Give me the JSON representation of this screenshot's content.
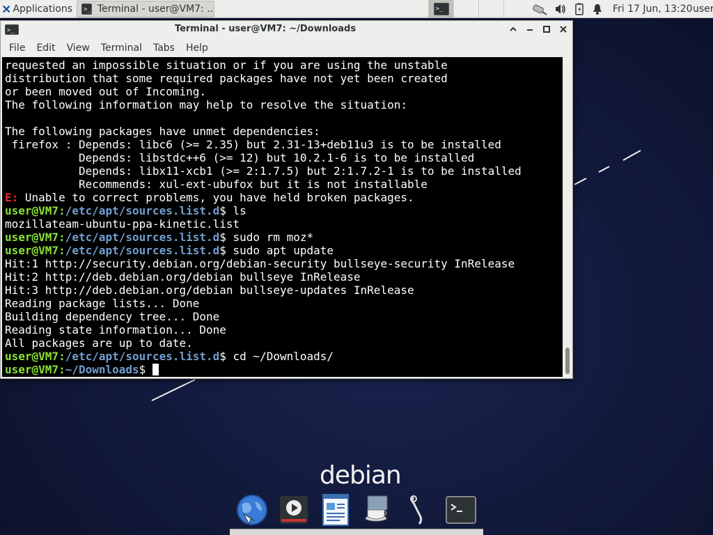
{
  "panel": {
    "applications_label": "Applications",
    "task_label": "Terminal - user@VM7: ...",
    "clock": "Fri 17 Jun, 13:20",
    "user": "user"
  },
  "window": {
    "title": "Terminal - user@VM7: ~/Downloads",
    "menu": [
      "File",
      "Edit",
      "View",
      "Terminal",
      "Tabs",
      "Help"
    ]
  },
  "terminal": {
    "lines": [
      {
        "text": "requested an impossible situation or if you are using the unstable"
      },
      {
        "text": "distribution that some required packages have not yet been created"
      },
      {
        "text": "or been moved out of Incoming."
      },
      {
        "text": "The following information may help to resolve the situation:"
      },
      {
        "text": ""
      },
      {
        "text": "The following packages have unmet dependencies:"
      },
      {
        "text": " firefox : Depends: libc6 (>= 2.35) but 2.31-13+deb11u3 is to be installed"
      },
      {
        "text": "           Depends: libstdc++6 (>= 12) but 10.2.1-6 is to be installed"
      },
      {
        "text": "           Depends: libx11-xcb1 (>= 2:1.7.5) but 2:1.7.2-1 is to be installed"
      },
      {
        "text": "           Recommends: xul-ext-ubufox but it is not installable"
      },
      {
        "error_tag": "E:",
        "text": " Unable to correct problems, you have held broken packages."
      },
      {
        "user": "user@VM7",
        "path": "/etc/apt/sources.list.d",
        "cmd": "$ ls"
      },
      {
        "text": "mozillateam-ubuntu-ppa-kinetic.list"
      },
      {
        "user": "user@VM7",
        "path": "/etc/apt/sources.list.d",
        "cmd": "$ sudo rm moz*"
      },
      {
        "user": "user@VM7",
        "path": "/etc/apt/sources.list.d",
        "cmd": "$ sudo apt update"
      },
      {
        "text": "Hit:1 http://security.debian.org/debian-security bullseye-security InRelease"
      },
      {
        "text": "Hit:2 http://deb.debian.org/debian bullseye InRelease"
      },
      {
        "text": "Hit:3 http://deb.debian.org/debian bullseye-updates InRelease"
      },
      {
        "text": "Reading package lists... Done"
      },
      {
        "text": "Building dependency tree... Done"
      },
      {
        "text": "Reading state information... Done"
      },
      {
        "text": "All packages are up to date."
      },
      {
        "user": "user@VM7",
        "path": "/etc/apt/sources.list.d",
        "cmd": "$ cd ~/Downloads/"
      },
      {
        "user": "user@VM7",
        "path": "~/Downloads",
        "cmd": "$ ",
        "cursor": true
      }
    ]
  },
  "desktop": {
    "logo_text": "debian",
    "dock_items": [
      "web-browser-icon",
      "media-player-icon",
      "text-editor-icon",
      "java-coffee-icon",
      "network-manager-icon",
      "terminal-icon"
    ]
  }
}
